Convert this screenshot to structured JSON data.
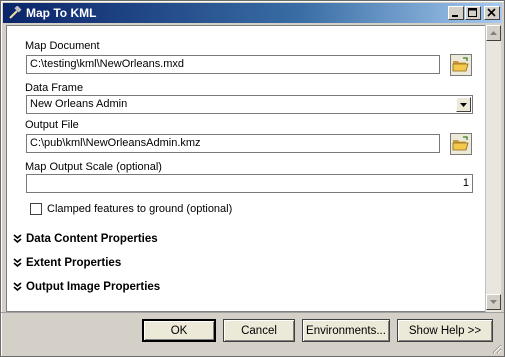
{
  "window": {
    "title": "Map To KML"
  },
  "form": {
    "map_document": {
      "label": "Map Document",
      "value": "C:\\testing\\kml\\NewOrleans.mxd"
    },
    "data_frame": {
      "label": "Data Frame",
      "value": "New Orleans Admin"
    },
    "output_file": {
      "label": "Output File",
      "value": "C:\\pub\\kml\\NewOrleansAdmin.kmz"
    },
    "map_output_scale": {
      "label": "Map Output Scale (optional)",
      "value": "1"
    },
    "clamped": {
      "label": "Clamped features to ground (optional)",
      "checked": false
    }
  },
  "sections": [
    {
      "label": "Data Content Properties"
    },
    {
      "label": "Extent Properties"
    },
    {
      "label": "Output Image Properties"
    }
  ],
  "buttons": {
    "ok": "OK",
    "cancel": "Cancel",
    "environments": "Environments...",
    "show_help": "Show Help >>"
  },
  "icons": {
    "window": "hammer-icon",
    "browse": "folder-open-icon",
    "expand": "double-chevron-down-icon"
  }
}
